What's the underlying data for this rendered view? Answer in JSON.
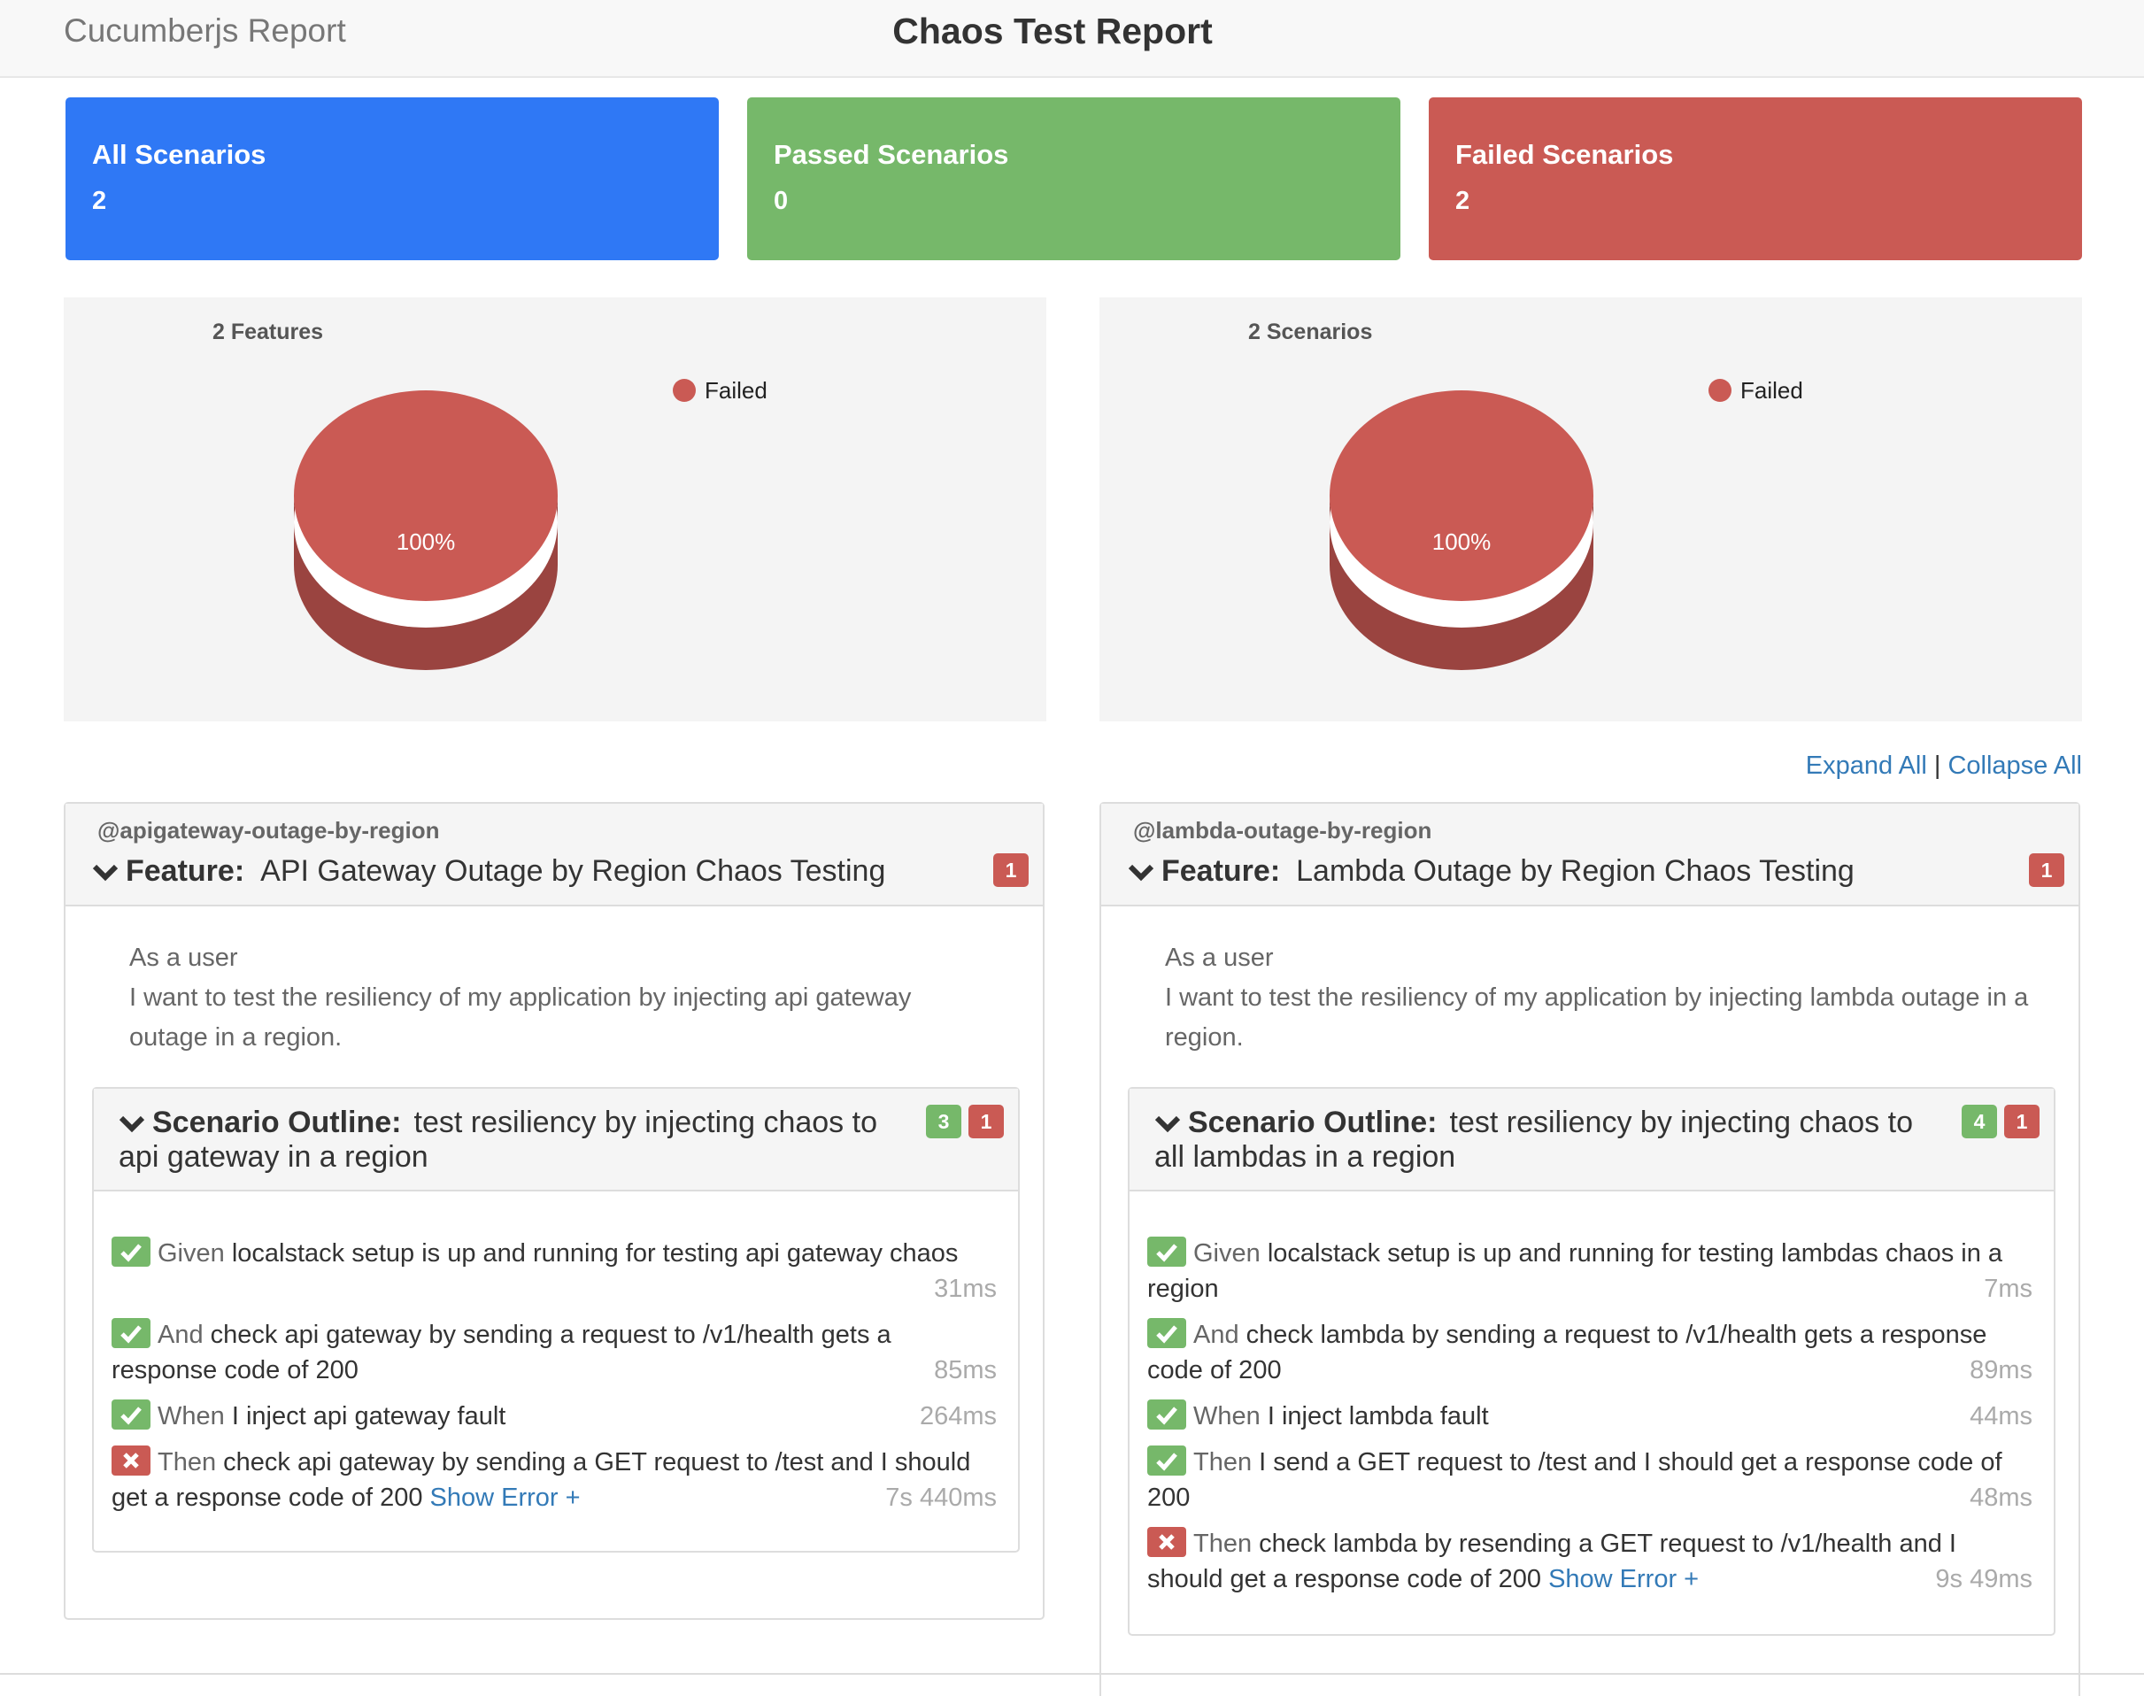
{
  "nav": {
    "brand": "Cucumberjs Report",
    "title": "Chaos Test Report"
  },
  "summary": [
    {
      "label": "All Scenarios",
      "value": "2",
      "color": "#2f78f5"
    },
    {
      "label": "Passed Scenarios",
      "value": "0",
      "color": "#76b86a"
    },
    {
      "label": "Failed Scenarios",
      "value": "2",
      "color": "#ca5a54"
    }
  ],
  "chart_data": [
    {
      "type": "pie",
      "title": "2 Features",
      "categories": [
        "Failed"
      ],
      "values": [
        100
      ],
      "labels": [
        "100%"
      ],
      "colors": [
        "#ca5a54"
      ],
      "legend": "top-right"
    },
    {
      "type": "pie",
      "title": "2 Scenarios",
      "categories": [
        "Failed"
      ],
      "values": [
        100
      ],
      "labels": [
        "100%"
      ],
      "colors": [
        "#ca5a54"
      ],
      "legend": "top-right"
    }
  ],
  "links": {
    "expand": "Expand All",
    "separator": "|",
    "collapse": "Collapse All"
  },
  "features": [
    {
      "tag": "@apigateway-outage-by-region",
      "keyword": "Feature:",
      "name": "API Gateway Outage by Region Chaos Testing",
      "failed_count": "1",
      "description": [
        "As a user",
        "I want to test the resiliency of my application by injecting api gateway outage in a region."
      ],
      "scenario": {
        "keyword": "Scenario Outline:",
        "name": "test resiliency by injecting chaos to api gateway in a region",
        "passed_count": "3",
        "failed_count": "1",
        "steps": [
          {
            "status": "passed",
            "keyword": "Given",
            "text": "localstack setup is up and running for testing api gateway chaos",
            "duration": "31ms"
          },
          {
            "status": "passed",
            "keyword": "And",
            "text": "check api gateway by sending a request to /v1/health gets a response code of 200",
            "duration": "85ms"
          },
          {
            "status": "passed",
            "keyword": "When",
            "text": "I inject api gateway fault",
            "duration": "264ms"
          },
          {
            "status": "failed",
            "keyword": "Then",
            "text": "check api gateway by sending a GET request to /test and I should get a response code of 200",
            "error_link": "Show Error +",
            "duration": "7s 440ms"
          }
        ]
      }
    },
    {
      "tag": "@lambda-outage-by-region",
      "keyword": "Feature:",
      "name": "Lambda Outage by Region Chaos Testing",
      "failed_count": "1",
      "description": [
        "As a user",
        "I want to test the resiliency of my application by injecting lambda outage in a region."
      ],
      "scenario": {
        "keyword": "Scenario Outline:",
        "name": "test resiliency by injecting chaos to all lambdas in a region",
        "passed_count": "4",
        "failed_count": "1",
        "steps": [
          {
            "status": "passed",
            "keyword": "Given",
            "text": "localstack setup is up and running for testing lambdas chaos in a region",
            "duration": "7ms"
          },
          {
            "status": "passed",
            "keyword": "And",
            "text": "check lambda by sending a request to /v1/health gets a response code of 200",
            "duration": "89ms"
          },
          {
            "status": "passed",
            "keyword": "When",
            "text": "I inject lambda fault",
            "duration": "44ms"
          },
          {
            "status": "passed",
            "keyword": "Then",
            "text": "I send a GET request to /test and I should get a response code of 200",
            "duration": "48ms"
          },
          {
            "status": "failed",
            "keyword": "Then",
            "text": "check lambda by resending a GET request to /v1/health and I should get a response code of 200",
            "error_link": "Show Error +",
            "duration": "9s 49ms"
          }
        ]
      }
    }
  ]
}
